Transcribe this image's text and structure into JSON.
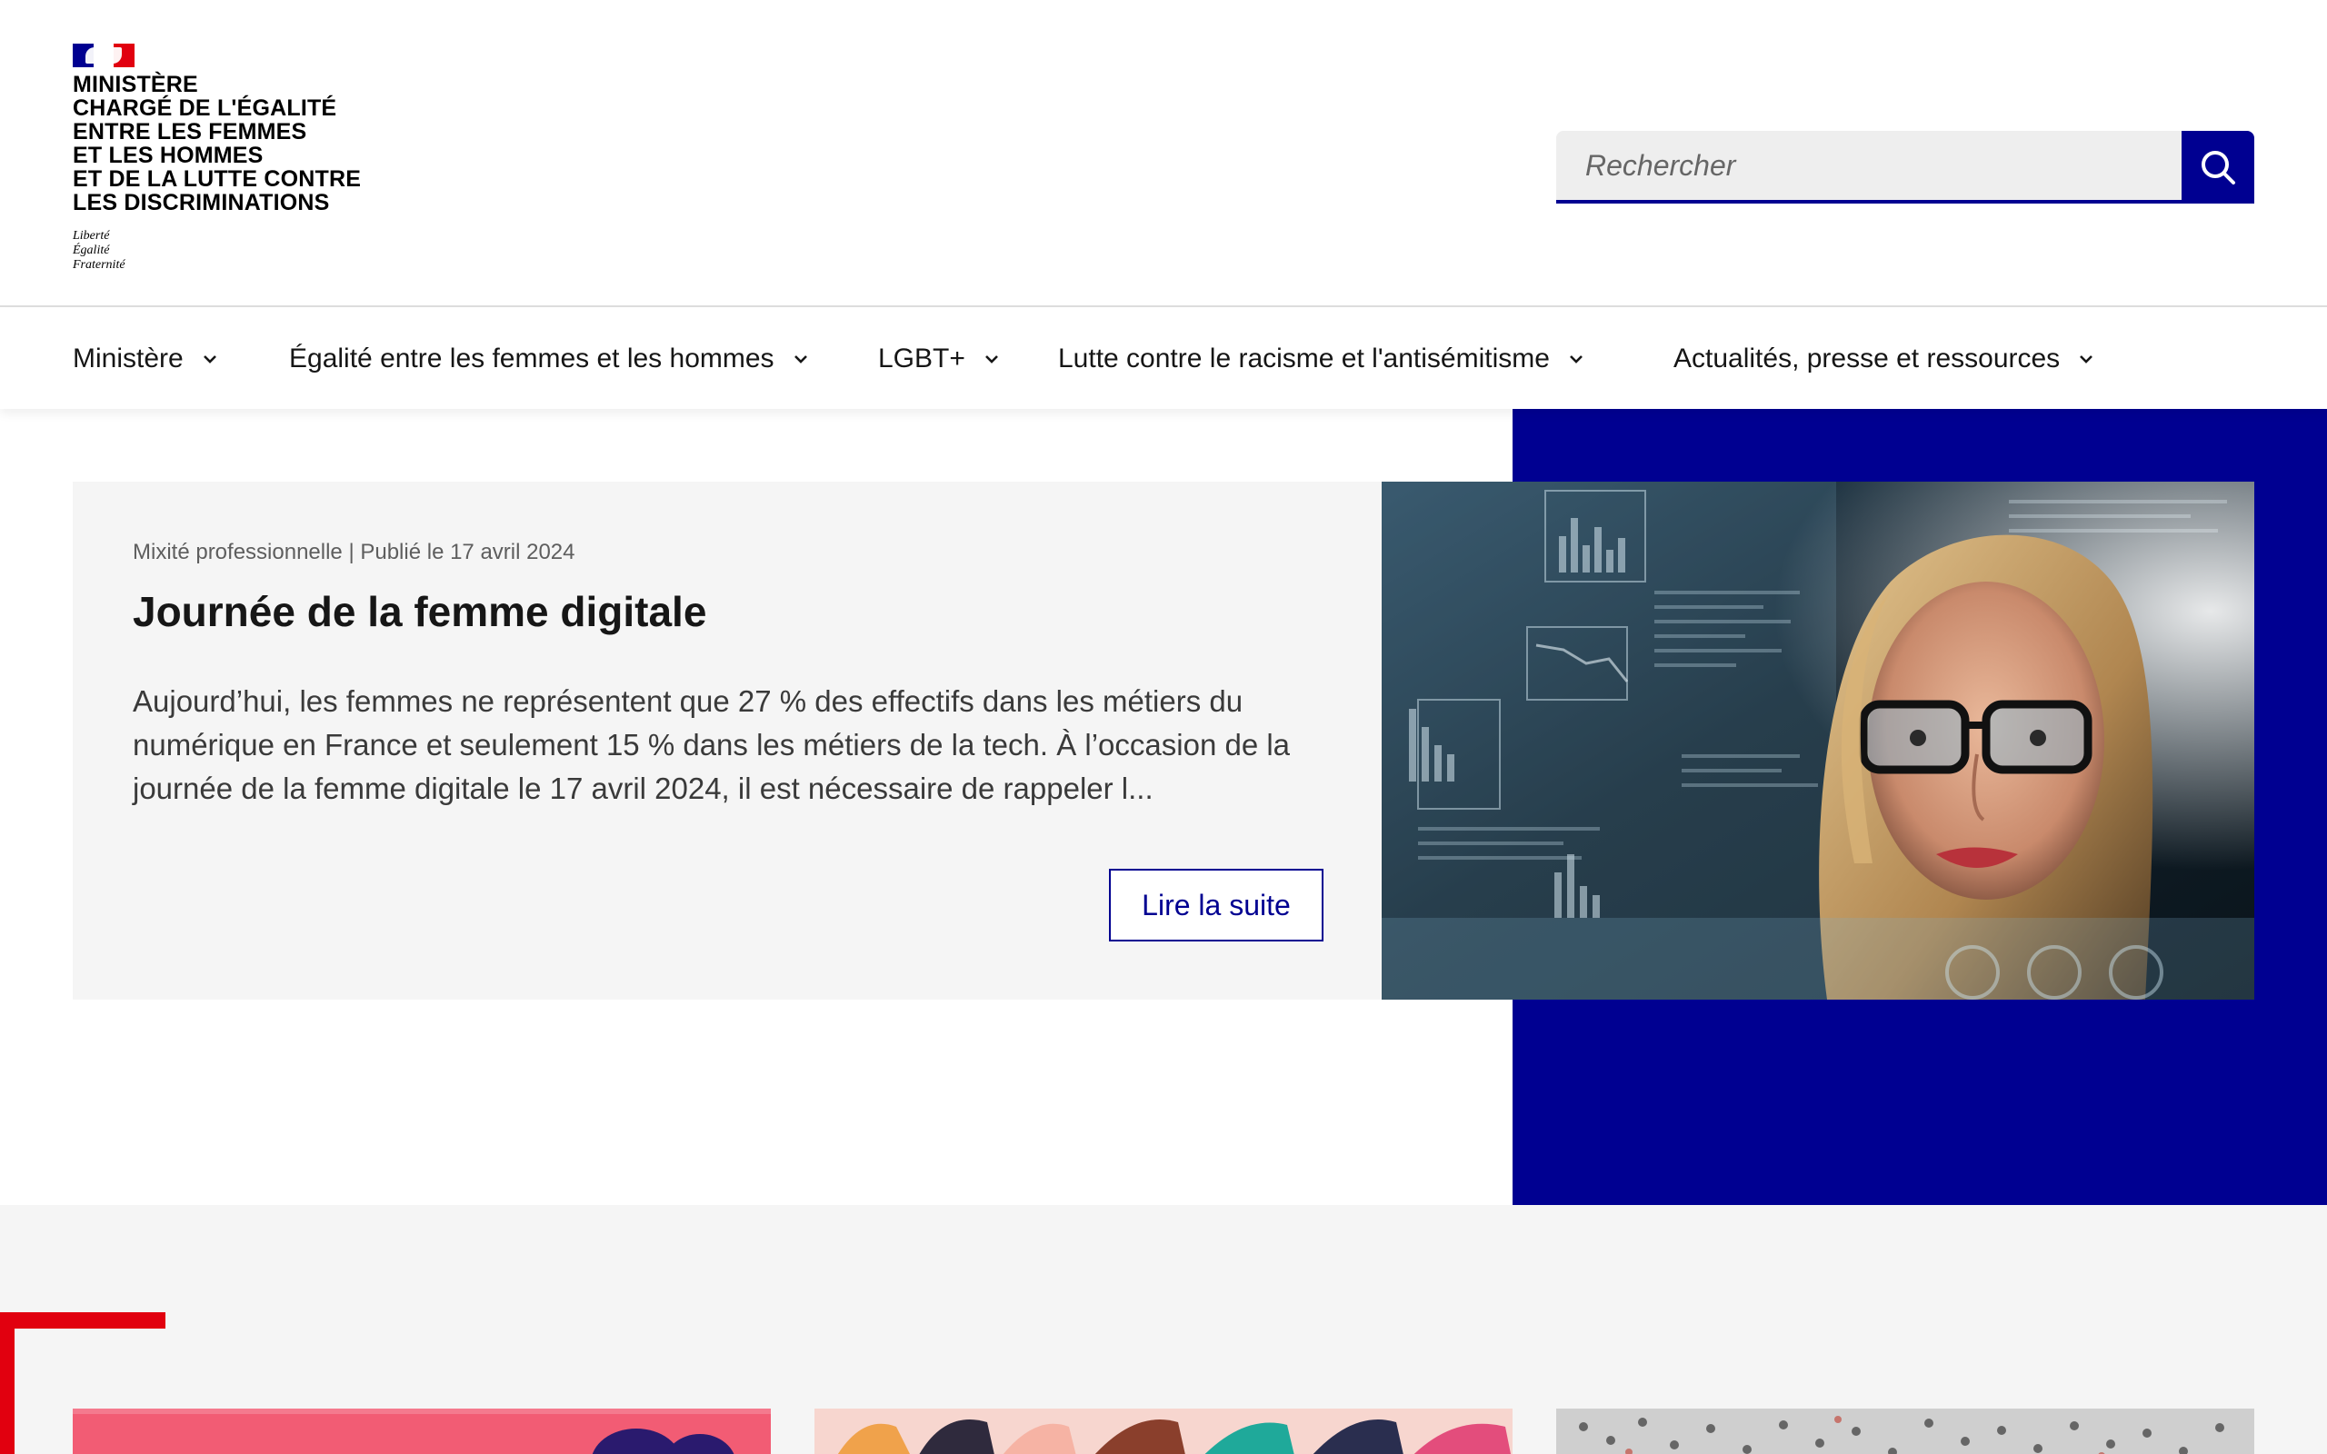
{
  "header": {
    "ministry_lines": [
      "MINISTÈRE",
      "CHARGÉ DE L'ÉGALITÉ",
      "ENTRE LES FEMMES",
      "ET LES HOMMES",
      "ET DE LA LUTTE CONTRE",
      "LES DISCRIMINATIONS"
    ],
    "motto_lines": [
      "Liberté",
      "Égalité",
      "Fraternité"
    ],
    "search": {
      "placeholder": "Rechercher",
      "icon": "search-icon"
    }
  },
  "nav": {
    "items": [
      {
        "label": "Ministère"
      },
      {
        "label": "Égalité entre les femmes et les hommes"
      },
      {
        "label": "LGBT+"
      },
      {
        "label": "Lutte contre le racisme et l'antisémitisme"
      },
      {
        "label": "Actualités, presse et ressources"
      }
    ],
    "dropdown_icon": "chevron-down-icon"
  },
  "hero": {
    "meta": "Mixité professionnelle | Publié le 17 avril 2024",
    "title": "Journée de la femme digitale",
    "description": "Aujourd’hui, les femmes ne représentent que 27 % des effectifs dans les métiers du numérique en France et seulement 15 % dans les métiers de la tech. À l’occasion de la journée de la femme digitale le 17 avril 2024, il est nécessaire de rappeler l...",
    "button_label": "Lire la suite",
    "image_subject": "woman-with-glasses-digital-data"
  },
  "colors": {
    "brand_blue": "#000091",
    "brand_red": "#e1000f",
    "grey_bg": "#f5f5f5",
    "text": "#161616"
  }
}
